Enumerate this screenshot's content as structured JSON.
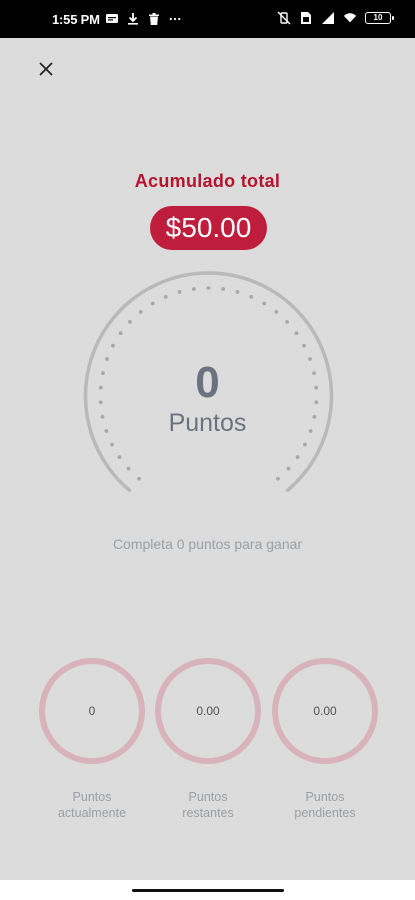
{
  "status_bar": {
    "time": "1:55 PM",
    "battery_level": "10",
    "left_icons": [
      "message-icon",
      "download-icon",
      "trash-icon",
      "more-icon"
    ],
    "right_icons": [
      "vibrate-off-icon",
      "sim-icon",
      "signal-icon",
      "wifi-icon"
    ]
  },
  "header": {
    "close_icon": "close-icon"
  },
  "summary": {
    "accumulated_label": "Acumulado total",
    "accumulated_value": "$50.00"
  },
  "gauge": {
    "value": "0",
    "unit": "Puntos",
    "progress": 0
  },
  "hint": "Completa 0 puntos para ganar",
  "stats": [
    {
      "value": "0",
      "label_line1": "Puntos",
      "label_line2": "actualmente"
    },
    {
      "value": "0.00",
      "label_line1": "Puntos",
      "label_line2": "restantes"
    },
    {
      "value": "0.00",
      "label_line1": "Puntos",
      "label_line2": "pendientes"
    }
  ],
  "colors": {
    "accent": "#bf1d3c",
    "accent_text": "#b8122f",
    "background": "#dcdcdc",
    "gauge_track": "#b9b9b9",
    "stat_ring": "#d8b3bb"
  }
}
